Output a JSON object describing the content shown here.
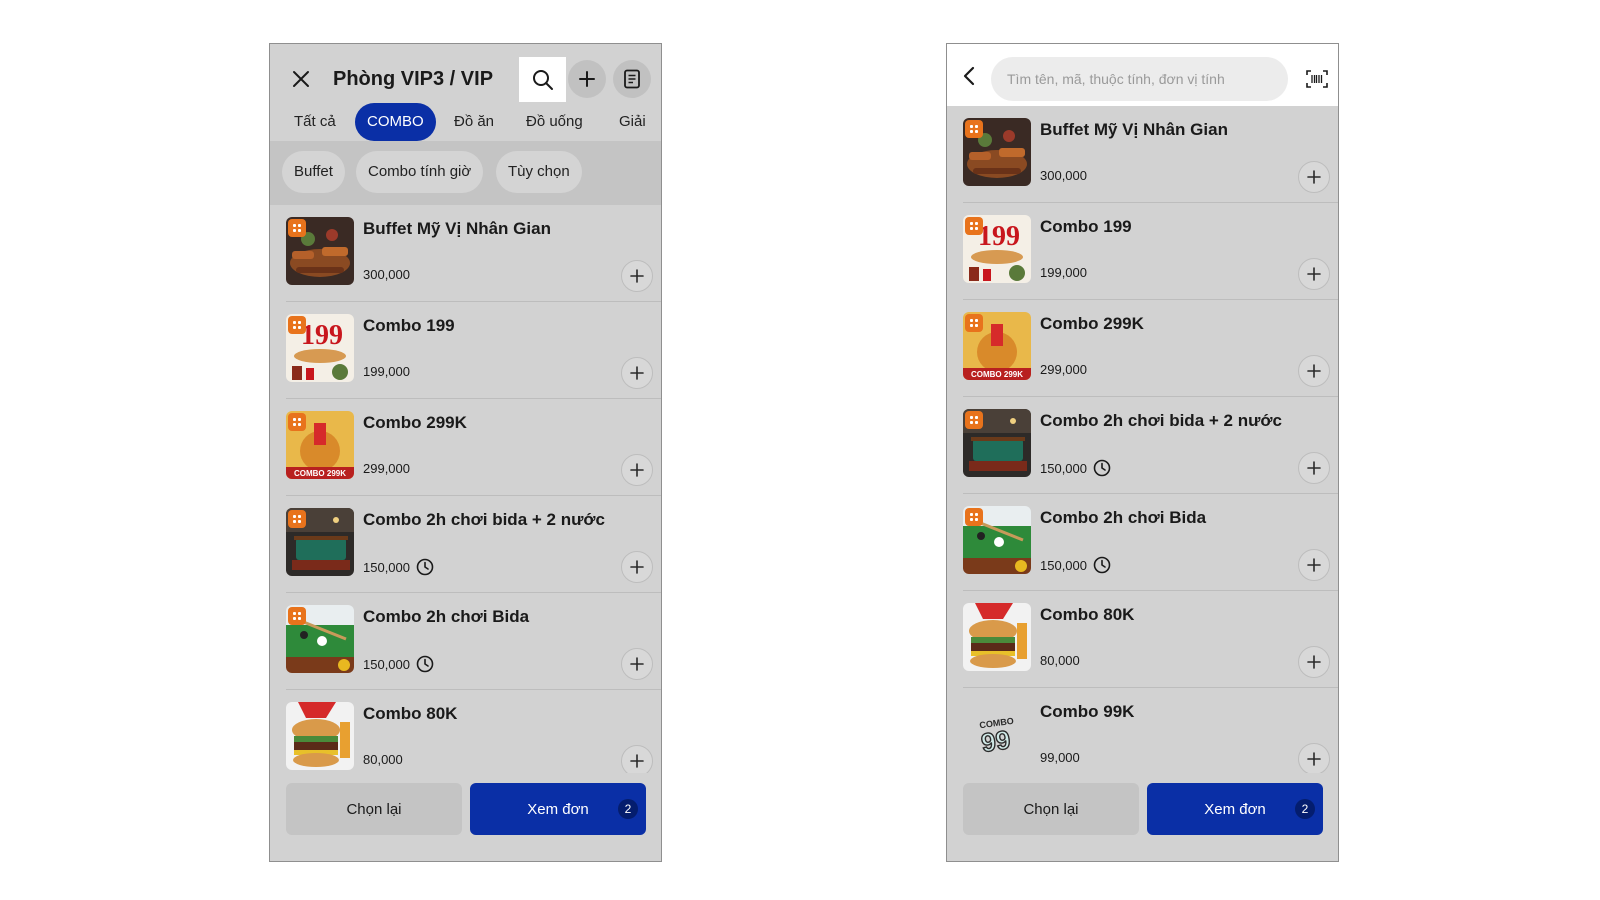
{
  "left": {
    "header": {
      "title": "Phòng VIP3 / VIP"
    },
    "tabs": [
      {
        "label": "Tất cả"
      },
      {
        "label": "COMBO"
      },
      {
        "label": "Đồ ăn"
      },
      {
        "label": "Đồ uống"
      },
      {
        "label": "Giải"
      }
    ],
    "chips": [
      {
        "label": "Buffet"
      },
      {
        "label": "Combo tính giờ"
      },
      {
        "label": "Tùy chọn"
      }
    ],
    "items": [
      {
        "name": "Buffet Mỹ Vị Nhân Gian",
        "price": "300,000",
        "timed": false
      },
      {
        "name": "Combo 199",
        "price": "199,000",
        "timed": false
      },
      {
        "name": "Combo 299K",
        "price": "299,000",
        "timed": false
      },
      {
        "name": "Combo 2h chơi bida + 2 nước",
        "price": "150,000",
        "timed": true
      },
      {
        "name": "Combo 2h chơi Bida",
        "price": "150,000",
        "timed": true
      },
      {
        "name": "Combo 80K",
        "price": "80,000",
        "timed": false
      }
    ],
    "footer": {
      "reset_label": "Chọn lại",
      "view_label": "Xem đơn",
      "count": "2"
    }
  },
  "right": {
    "search": {
      "placeholder": "Tìm tên, mã, thuộc tính, đơn vị tính"
    },
    "items": [
      {
        "name": "Buffet Mỹ Vị Nhân Gian",
        "price": "300,000",
        "timed": false
      },
      {
        "name": "Combo 199",
        "price": "199,000",
        "timed": false
      },
      {
        "name": "Combo 299K",
        "price": "299,000",
        "timed": false
      },
      {
        "name": "Combo 2h chơi bida + 2 nước",
        "price": "150,000",
        "timed": true
      },
      {
        "name": "Combo 2h chơi Bida",
        "price": "150,000",
        "timed": true
      },
      {
        "name": "Combo 80K",
        "price": "80,000",
        "timed": false
      },
      {
        "name": "Combo 99K",
        "price": "99,000",
        "timed": false
      }
    ],
    "footer": {
      "reset_label": "Chọn lại",
      "view_label": "Xem đơn",
      "count": "2"
    }
  },
  "thumb_texts": {
    "combo199": "199",
    "combo299": "COMBO 299K",
    "combo99_top": "COMBO",
    "combo99_num": "99"
  },
  "colors": {
    "accent": "#0a2fa6",
    "badge": "#e8731c",
    "background": "#d2d2d2"
  }
}
